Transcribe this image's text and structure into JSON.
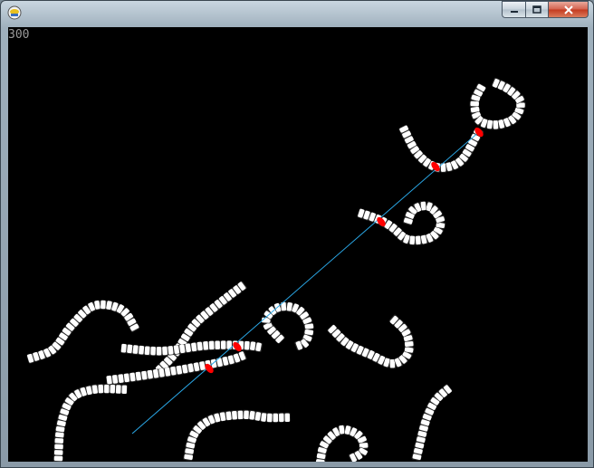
{
  "game": {
    "score": "300"
  },
  "colors": {
    "background": "#000000",
    "segment": "#ffffff",
    "segment_shadow": "#2a2a2a",
    "hit_marker": "#ff0000",
    "laser": "#2aa7e6"
  }
}
